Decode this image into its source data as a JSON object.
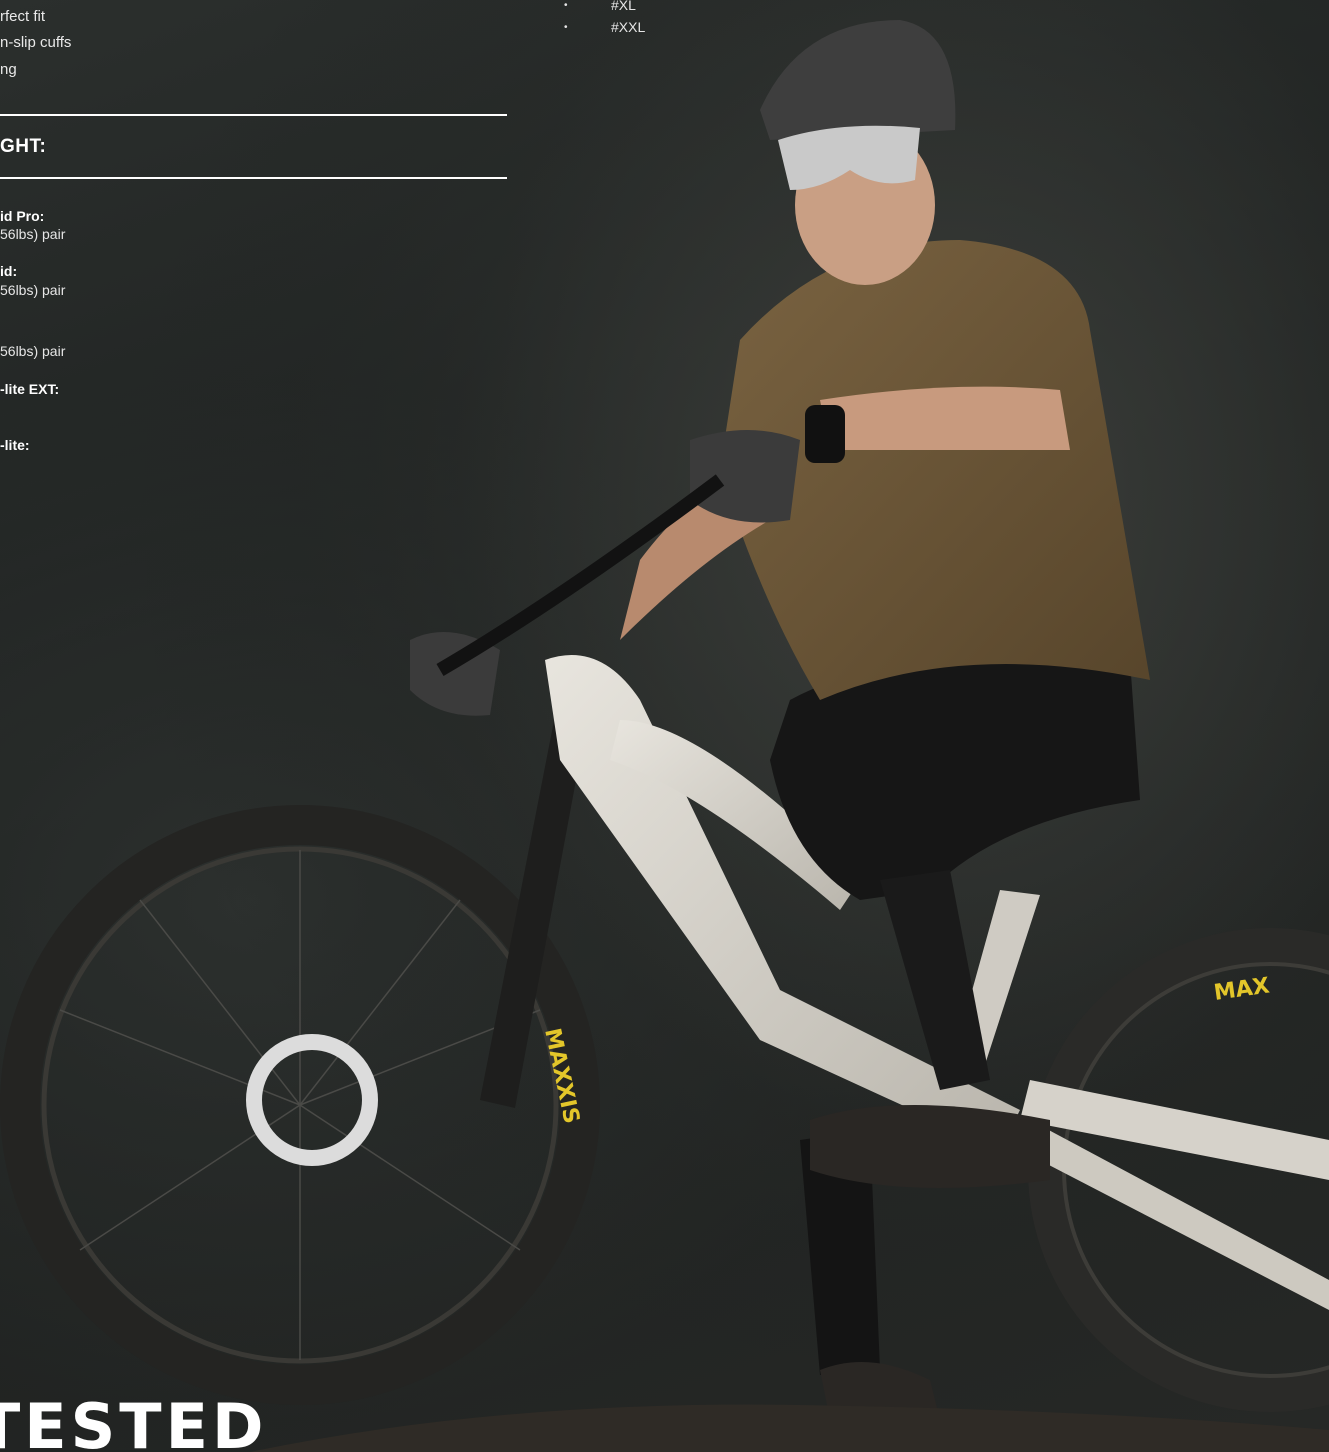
{
  "features": [
    "rfect fit",
    "n-slip cuffs",
    "ng"
  ],
  "weight_heading": "GHT:",
  "weights": [
    {
      "name": "id Pro:",
      "value": "56lbs) pair"
    },
    {
      "name": "id:",
      "value": "56lbs) pair"
    },
    {
      "name": "",
      "value": "56lbs) pair"
    },
    {
      "name": "-lite EXT:",
      "value": ""
    },
    {
      "name": "-lite:",
      "value": ""
    }
  ],
  "sizes": [
    {
      "bullet": "•",
      "label": "#XL"
    },
    {
      "bullet": "•",
      "label": "#XXL"
    }
  ],
  "footer_title": "TESTED",
  "colors": {
    "text": "#ffffff",
    "background": "#1c1f1e",
    "jersey": "#6b5535",
    "bike_frame": "#d9d6cf",
    "tire_logo": "#e3c62a"
  }
}
